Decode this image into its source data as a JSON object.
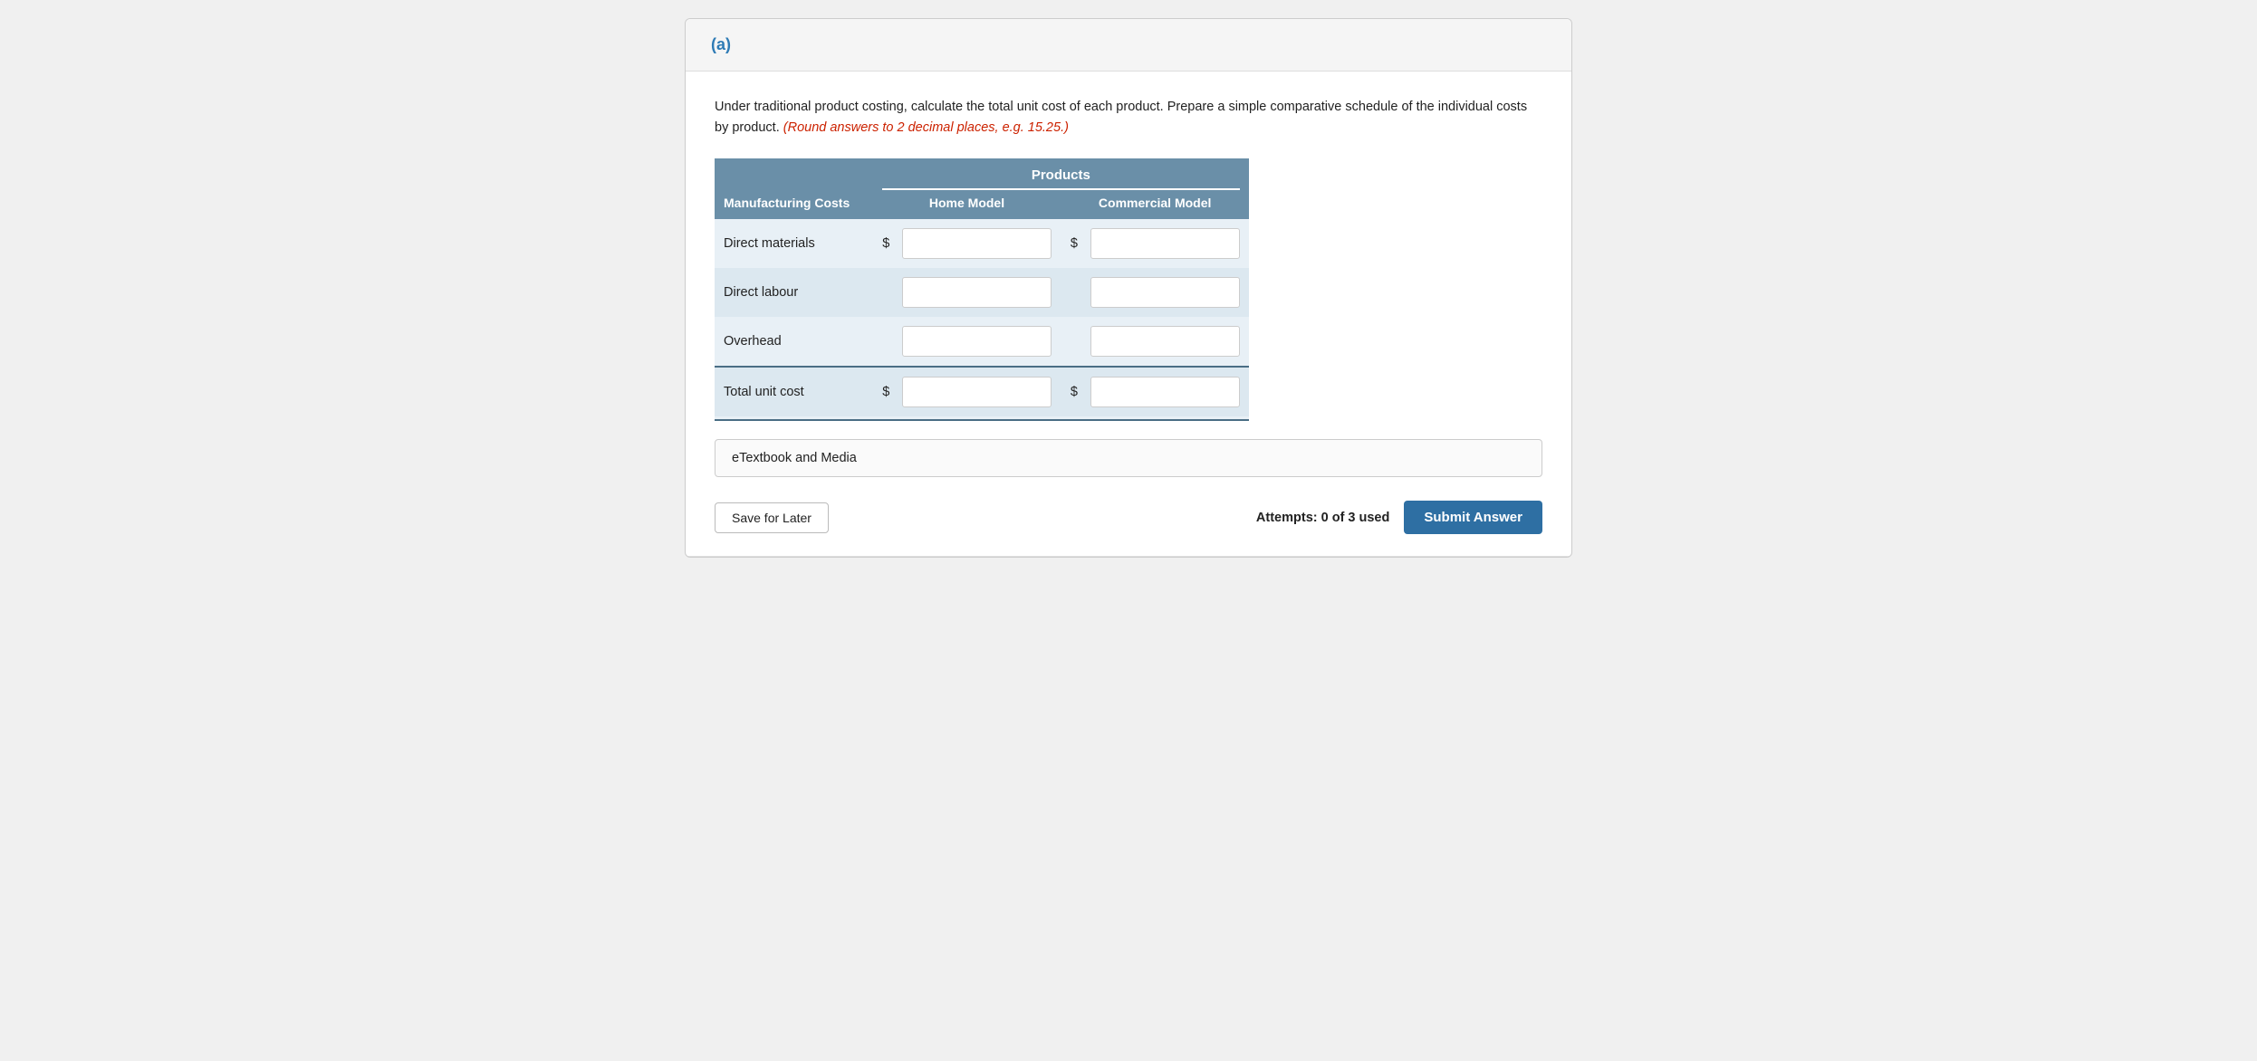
{
  "part": {
    "label": "(a)"
  },
  "instructions": {
    "main": "Under traditional product costing, calculate the total unit cost of each product. Prepare a simple comparative schedule of the individual costs by product.",
    "round_note": "(Round answers to 2 decimal places, e.g. 15.25.)"
  },
  "table": {
    "products_header": "Products",
    "col_manufacturing": "Manufacturing Costs",
    "col_home": "Home Model",
    "col_commercial": "Commercial Model",
    "rows": [
      {
        "label": "Direct materials",
        "show_dollar": true,
        "home_value": "",
        "commercial_value": ""
      },
      {
        "label": "Direct labour",
        "show_dollar": false,
        "home_value": "",
        "commercial_value": ""
      },
      {
        "label": "Overhead",
        "show_dollar": false,
        "home_value": "",
        "commercial_value": ""
      },
      {
        "label": "Total unit cost",
        "show_dollar": true,
        "home_value": "",
        "commercial_value": "",
        "is_total": true
      }
    ]
  },
  "etextbook": {
    "label": "eTextbook and Media"
  },
  "footer": {
    "save_label": "Save for Later",
    "attempts_label": "Attempts: 0 of 3 used",
    "submit_label": "Submit Answer"
  }
}
